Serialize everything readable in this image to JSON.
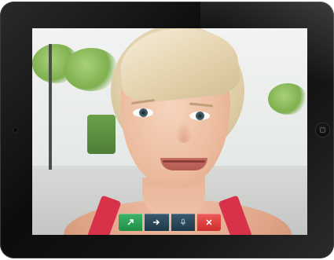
{
  "device": {
    "type": "tablet",
    "bezel_color": "#111111"
  },
  "screen": {
    "content": "video-call",
    "controls": [
      {
        "name": "answer-video-icon",
        "color": "#2a9e55"
      },
      {
        "name": "arrow-right-icon",
        "color": "#26455a"
      },
      {
        "name": "microphone-icon",
        "color": "#26455a"
      },
      {
        "name": "end-call-icon",
        "color": "#e04442"
      }
    ]
  }
}
